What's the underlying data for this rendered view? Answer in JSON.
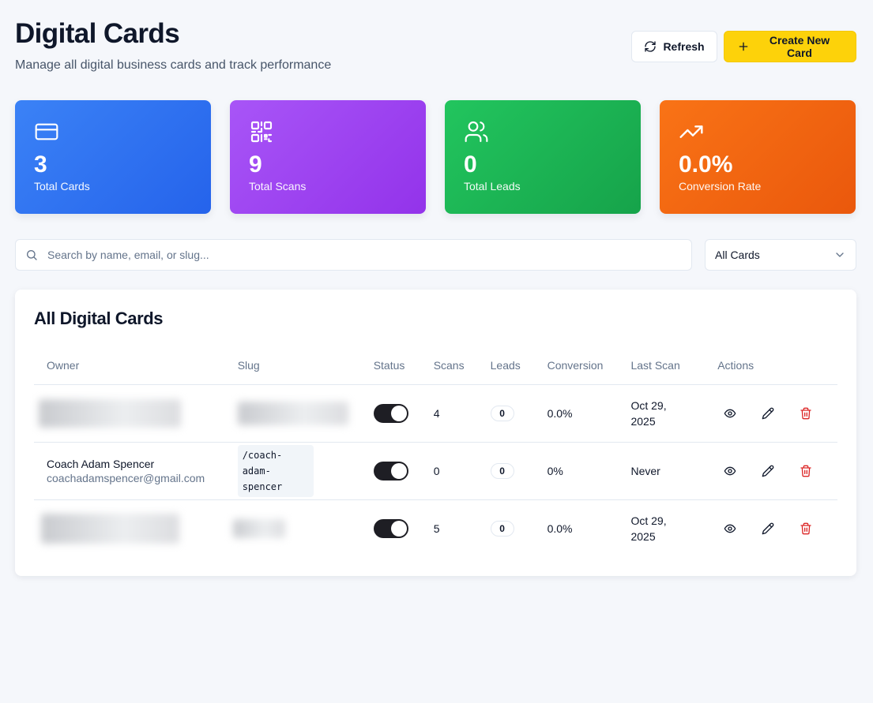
{
  "header": {
    "title": "Digital Cards",
    "subtitle": "Manage all digital business cards and track performance",
    "refresh_label": "Refresh",
    "create_label": "Create New Card"
  },
  "stats": [
    {
      "value": "3",
      "label": "Total Cards",
      "icon": "credit-card-icon",
      "color": "#3b82f6"
    },
    {
      "value": "9",
      "label": "Total Scans",
      "icon": "qr-code-icon",
      "color": "#a855f7"
    },
    {
      "value": "0",
      "label": "Total Leads",
      "icon": "users-icon",
      "color": "#22c55e"
    },
    {
      "value": "0.0%",
      "label": "Conversion Rate",
      "icon": "trending-up-icon",
      "color": "#f97316"
    }
  ],
  "search": {
    "placeholder": "Search by name, email, or slug...",
    "value": ""
  },
  "filter": {
    "selected": "All Cards"
  },
  "table": {
    "title": "All Digital Cards",
    "columns": [
      "Owner",
      "Slug",
      "Status",
      "Scans",
      "Leads",
      "Conversion",
      "Last Scan",
      "Actions"
    ],
    "rows": [
      {
        "owner_name": "",
        "owner_email": "",
        "slug": "",
        "status": "on",
        "scans": "4",
        "leads": "0",
        "conversion": "0.0%",
        "last_scan": "Oct 29, 2025"
      },
      {
        "owner_name": "Coach Adam Spencer",
        "owner_email": "coachadamspencer@gmail.com",
        "slug": "/coach-adam-spencer",
        "status": "on",
        "scans": "0",
        "leads": "0",
        "conversion": "0%",
        "last_scan": "Never"
      },
      {
        "owner_name": "",
        "owner_email": "",
        "slug": "",
        "status": "on",
        "scans": "5",
        "leads": "0",
        "conversion": "0.0%",
        "last_scan": "Oct 29, 2025"
      }
    ]
  },
  "colors": {
    "accent": "#fdd20a",
    "danger": "#dc2626"
  }
}
